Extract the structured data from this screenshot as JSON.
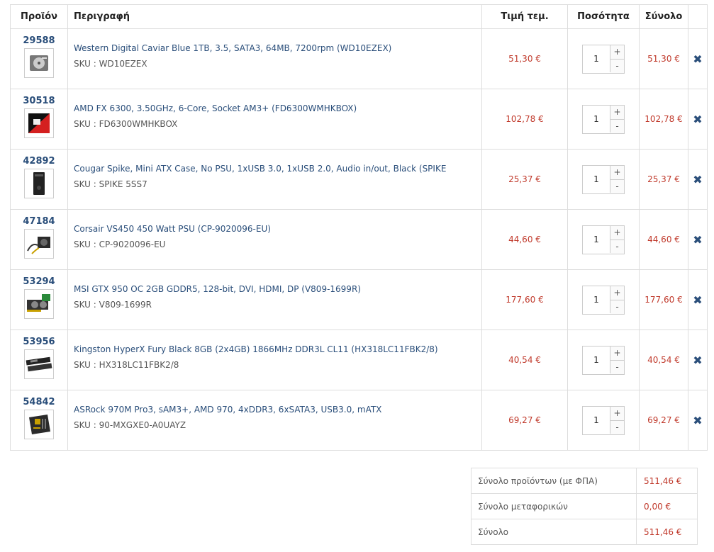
{
  "header": {
    "product": "Προϊόν",
    "description": "Περιγραφή",
    "unit_price": "Τιμή τεμ.",
    "quantity": "Ποσότητα",
    "total": "Σύνολο"
  },
  "sku_prefix": "SKU : ",
  "items": [
    {
      "code": "29588",
      "name": "Western Digital Caviar Blue 1TB, 3.5, SATA3, 64MB, 7200rpm (WD10EZEX)",
      "sku": "WD10EZEX",
      "price": "51,30 €",
      "qty": "1",
      "total": "51,30 €",
      "thumb": "hdd"
    },
    {
      "code": "30518",
      "name": "AMD FX 6300, 3.50GHz, 6-Core, Socket AM3+ (FD6300WMHKBOX)",
      "sku": "FD6300WMHKBOX",
      "price": "102,78 €",
      "qty": "1",
      "total": "102,78 €",
      "thumb": "cpu"
    },
    {
      "code": "42892",
      "name": "Cougar Spike, Mini ATX Case, No PSU, 1xUSB 3.0, 1xUSB 2.0, Audio in/out, Black (SPIKE",
      "sku": "SPIKE 5SS7",
      "price": "25,37 €",
      "qty": "1",
      "total": "25,37 €",
      "thumb": "case"
    },
    {
      "code": "47184",
      "name": "Corsair VS450 450 Watt PSU (CP-9020096-EU)",
      "sku": "CP-9020096-EU",
      "price": "44,60 €",
      "qty": "1",
      "total": "44,60 €",
      "thumb": "psu"
    },
    {
      "code": "53294",
      "name": "MSI GTX 950 OC 2GB GDDR5, 128-bit, DVI, HDMI, DP (V809-1699R)",
      "sku": "V809-1699R",
      "price": "177,60 €",
      "qty": "1",
      "total": "177,60 €",
      "thumb": "gpu"
    },
    {
      "code": "53956",
      "name": "Kingston HyperX Fury Black 8GB (2x4GB) 1866MHz DDR3L CL11 (HX318LC11FBK2/8)",
      "sku": "HX318LC11FBK2/8",
      "price": "40,54 €",
      "qty": "1",
      "total": "40,54 €",
      "thumb": "ram"
    },
    {
      "code": "54842",
      "name": "ASRock 970M Pro3, sAM3+, AMD 970, 4xDDR3, 6xSATA3, USB3.0, mATX",
      "sku": "90-MXGXE0-A0UAYZ",
      "price": "69,27 €",
      "qty": "1",
      "total": "69,27 €",
      "thumb": "mobo"
    }
  ],
  "stepper": {
    "plus": "+",
    "minus": "-"
  },
  "remove_glyph": "✖",
  "summary": [
    {
      "label": "Σύνολο προϊόντων (με ΦΠΑ)",
      "value": "511,46 €"
    },
    {
      "label": "Σύνολο μεταφορικών",
      "value": "0,00 €"
    },
    {
      "label": "Σύνολο",
      "value": "511,46 €"
    }
  ],
  "colors": {
    "link": "#2a4e7a",
    "price": "#c0392b",
    "border": "#dddddd"
  }
}
